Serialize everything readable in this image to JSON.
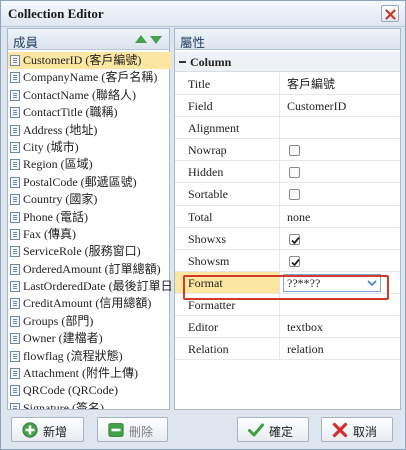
{
  "window": {
    "title": "Collection Editor"
  },
  "members": {
    "header": "成員",
    "items": [
      "CustomerID (客戶編號)",
      "CompanyName (客戶名稱)",
      "ContactName (聯絡人)",
      "ContactTitle (職稱)",
      "Address (地址)",
      "City (城市)",
      "Region (區域)",
      "PostalCode (郵遞區號)",
      "Country (國家)",
      "Phone (電話)",
      "Fax (傳真)",
      "ServiceRole (服務窗口)",
      "OrderedAmount (訂單總額)",
      "LastOrderedDate (最後訂單日",
      "CreditAmount (信用總額)",
      "Groups (部門)",
      "Owner (建檔者)",
      "flowflag (流程狀態)",
      "Attachment (附件上傳)",
      "QRCode (QRCode)",
      "Signature (簽名)"
    ],
    "selected_index": 0
  },
  "properties": {
    "header": "屬性",
    "group": "Column",
    "rows": [
      {
        "name": "Title",
        "value": "客戶編號"
      },
      {
        "name": "Field",
        "value": "CustomerID"
      },
      {
        "name": "Alignment",
        "value": ""
      },
      {
        "name": "Nowrap",
        "checkbox": false
      },
      {
        "name": "Hidden",
        "checkbox": false
      },
      {
        "name": "Sortable",
        "checkbox": false
      },
      {
        "name": "Total",
        "value": "none"
      },
      {
        "name": "Showxs",
        "checkbox": true
      },
      {
        "name": "Showsm",
        "checkbox": true
      },
      {
        "name": "Format",
        "value": "??**??",
        "editing": true
      },
      {
        "name": "Formatter",
        "value": ""
      },
      {
        "name": "Editor",
        "value": "textbox"
      },
      {
        "name": "Relation",
        "value": "relation"
      }
    ]
  },
  "buttons": {
    "add": "新增",
    "delete": "刪除",
    "ok": "確定",
    "cancel": "取消"
  },
  "colors": {
    "selection": "#fde6a2",
    "highlight_frame": "#d23a2a",
    "arrows": "#4aa04a"
  }
}
